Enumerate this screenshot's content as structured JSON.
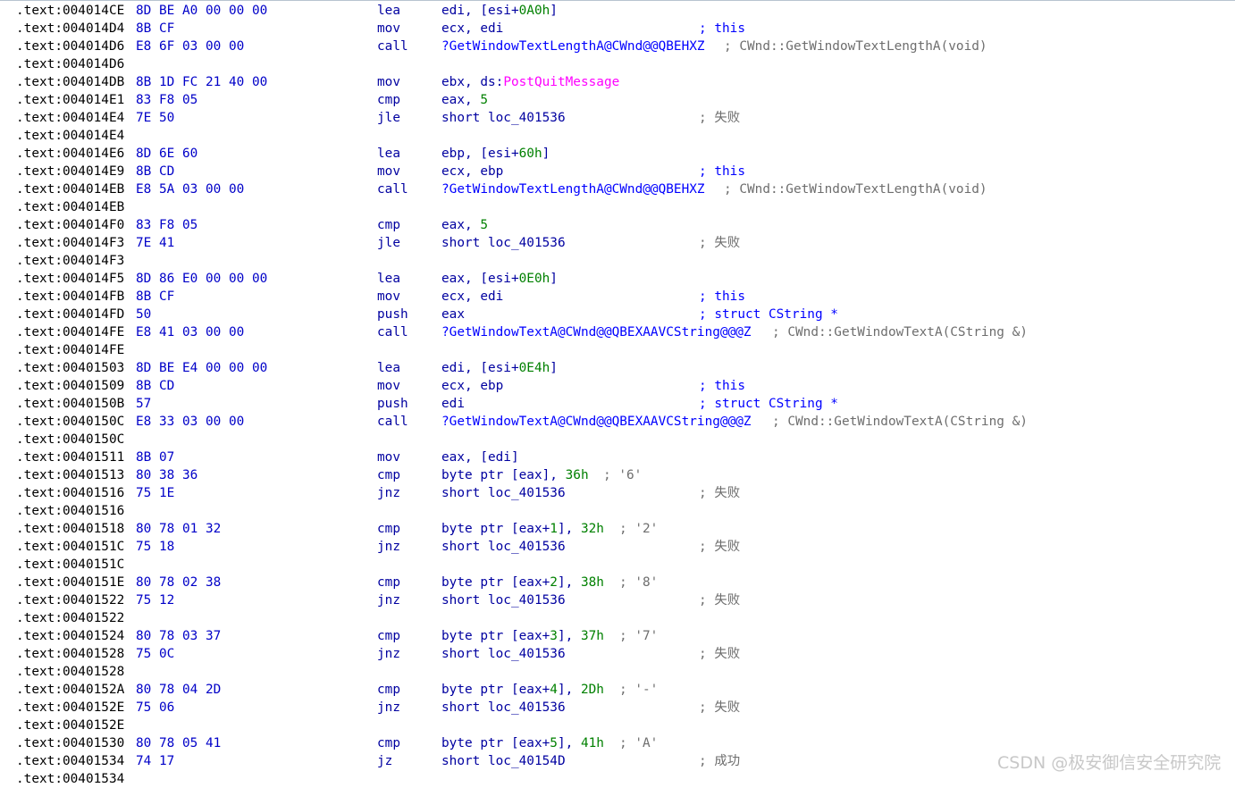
{
  "listing": {
    "lines": [
      {
        "addr": ".text:004014CE",
        "bytes": "8D BE A0 00 00 00",
        "mnem": "lea",
        "ops": [
          {
            "t": "edi, [esi+",
            "c": "reg"
          },
          {
            "t": "0A0h",
            "c": "num"
          },
          {
            "t": "]",
            "c": "reg"
          }
        ],
        "comment": ""
      },
      {
        "addr": ".text:004014D4",
        "bytes": "8B CF",
        "mnem": "mov",
        "ops": [
          {
            "t": "ecx, edi",
            "c": "reg"
          }
        ],
        "comment": "; this",
        "cmtStyle": "blue",
        "cmtCol": 782
      },
      {
        "addr": ".text:004014D6",
        "bytes": "E8 6F 03 00 00",
        "mnem": "call",
        "ops": [
          {
            "t": "?GetWindowTextLengthA@CWnd@@QBEHXZ",
            "c": "func"
          }
        ],
        "comment": "; CWnd::GetWindowTextLengthA(void)",
        "cmtCol": 810
      },
      {
        "addr": ".text:004014D6",
        "bytes": "",
        "mnem": "",
        "ops": [],
        "comment": ""
      },
      {
        "addr": ".text:004014DB",
        "bytes": "8B 1D FC 21 40 00",
        "mnem": "mov",
        "ops": [
          {
            "t": "ebx, ds:",
            "c": "reg"
          },
          {
            "t": "PostQuitMessage",
            "c": "name"
          }
        ],
        "comment": ""
      },
      {
        "addr": ".text:004014E1",
        "bytes": "83 F8 05",
        "mnem": "cmp",
        "ops": [
          {
            "t": "eax, ",
            "c": "reg"
          },
          {
            "t": "5",
            "c": "num"
          }
        ],
        "comment": ""
      },
      {
        "addr": ".text:004014E4",
        "bytes": "7E 50",
        "mnem": "jle",
        "ops": [
          {
            "t": "short loc_401536",
            "c": "loc"
          }
        ],
        "comment": "; 失败",
        "cmtCol": 782
      },
      {
        "addr": ".text:004014E4",
        "bytes": "",
        "mnem": "",
        "ops": [],
        "comment": ""
      },
      {
        "addr": ".text:004014E6",
        "bytes": "8D 6E 60",
        "mnem": "lea",
        "ops": [
          {
            "t": "ebp, [esi+",
            "c": "reg"
          },
          {
            "t": "60h",
            "c": "num"
          },
          {
            "t": "]",
            "c": "reg"
          }
        ],
        "comment": ""
      },
      {
        "addr": ".text:004014E9",
        "bytes": "8B CD",
        "mnem": "mov",
        "ops": [
          {
            "t": "ecx, ebp",
            "c": "reg"
          }
        ],
        "comment": "; this",
        "cmtStyle": "blue",
        "cmtCol": 782
      },
      {
        "addr": ".text:004014EB",
        "bytes": "E8 5A 03 00 00",
        "mnem": "call",
        "ops": [
          {
            "t": "?GetWindowTextLengthA@CWnd@@QBEHXZ",
            "c": "func"
          }
        ],
        "comment": "; CWnd::GetWindowTextLengthA(void)",
        "cmtCol": 810
      },
      {
        "addr": ".text:004014EB",
        "bytes": "",
        "mnem": "",
        "ops": [],
        "comment": ""
      },
      {
        "addr": ".text:004014F0",
        "bytes": "83 F8 05",
        "mnem": "cmp",
        "ops": [
          {
            "t": "eax, ",
            "c": "reg"
          },
          {
            "t": "5",
            "c": "num"
          }
        ],
        "comment": ""
      },
      {
        "addr": ".text:004014F3",
        "bytes": "7E 41",
        "mnem": "jle",
        "ops": [
          {
            "t": "short loc_401536",
            "c": "loc"
          }
        ],
        "comment": "; 失败",
        "cmtCol": 782
      },
      {
        "addr": ".text:004014F3",
        "bytes": "",
        "mnem": "",
        "ops": [],
        "comment": ""
      },
      {
        "addr": ".text:004014F5",
        "bytes": "8D 86 E0 00 00 00",
        "mnem": "lea",
        "ops": [
          {
            "t": "eax, [esi+",
            "c": "reg"
          },
          {
            "t": "0E0h",
            "c": "num"
          },
          {
            "t": "]",
            "c": "reg"
          }
        ],
        "comment": ""
      },
      {
        "addr": ".text:004014FB",
        "bytes": "8B CF",
        "mnem": "mov",
        "ops": [
          {
            "t": "ecx, edi",
            "c": "reg"
          }
        ],
        "comment": "; this",
        "cmtStyle": "blue",
        "cmtCol": 782
      },
      {
        "addr": ".text:004014FD",
        "bytes": "50",
        "mnem": "push",
        "ops": [
          {
            "t": "eax",
            "c": "reg"
          }
        ],
        "comment": "; struct CString *",
        "cmtStyle": "blue",
        "cmtCol": 782
      },
      {
        "addr": ".text:004014FE",
        "bytes": "E8 41 03 00 00",
        "mnem": "call",
        "ops": [
          {
            "t": "?GetWindowTextA@CWnd@@QBEXAAVCString@@@Z",
            "c": "func"
          }
        ],
        "comment": "; CWnd::GetWindowTextA(CString &)",
        "cmtCol": 864
      },
      {
        "addr": ".text:004014FE",
        "bytes": "",
        "mnem": "",
        "ops": [],
        "comment": ""
      },
      {
        "addr": ".text:00401503",
        "bytes": "8D BE E4 00 00 00",
        "mnem": "lea",
        "ops": [
          {
            "t": "edi, [esi+",
            "c": "reg"
          },
          {
            "t": "0E4h",
            "c": "num"
          },
          {
            "t": "]",
            "c": "reg"
          }
        ],
        "comment": ""
      },
      {
        "addr": ".text:00401509",
        "bytes": "8B CD",
        "mnem": "mov",
        "ops": [
          {
            "t": "ecx, ebp",
            "c": "reg"
          }
        ],
        "comment": "; this",
        "cmtStyle": "blue",
        "cmtCol": 782
      },
      {
        "addr": ".text:0040150B",
        "bytes": "57",
        "mnem": "push",
        "ops": [
          {
            "t": "edi",
            "c": "reg"
          }
        ],
        "comment": "; struct CString *",
        "cmtStyle": "blue",
        "cmtCol": 782
      },
      {
        "addr": ".text:0040150C",
        "bytes": "E8 33 03 00 00",
        "mnem": "call",
        "ops": [
          {
            "t": "?GetWindowTextA@CWnd@@QBEXAAVCString@@@Z",
            "c": "func"
          }
        ],
        "comment": "; CWnd::GetWindowTextA(CString &)",
        "cmtCol": 864
      },
      {
        "addr": ".text:0040150C",
        "bytes": "",
        "mnem": "",
        "ops": [],
        "comment": ""
      },
      {
        "addr": ".text:00401511",
        "bytes": "8B 07",
        "mnem": "mov",
        "ops": [
          {
            "t": "eax, [edi]",
            "c": "reg"
          }
        ],
        "comment": ""
      },
      {
        "addr": ".text:00401513",
        "bytes": "80 38 36",
        "mnem": "cmp",
        "ops": [
          {
            "t": "byte ptr [eax], ",
            "c": "reg"
          },
          {
            "t": "36h",
            "c": "num"
          }
        ],
        "comment": "; '6'",
        "cmtCol": 675
      },
      {
        "addr": ".text:00401516",
        "bytes": "75 1E",
        "mnem": "jnz",
        "ops": [
          {
            "t": "short loc_401536",
            "c": "loc"
          }
        ],
        "comment": "; 失败",
        "cmtCol": 782
      },
      {
        "addr": ".text:00401516",
        "bytes": "",
        "mnem": "",
        "ops": [],
        "comment": ""
      },
      {
        "addr": ".text:00401518",
        "bytes": "80 78 01 32",
        "mnem": "cmp",
        "ops": [
          {
            "t": "byte ptr [eax+",
            "c": "reg"
          },
          {
            "t": "1",
            "c": "num"
          },
          {
            "t": "], ",
            "c": "reg"
          },
          {
            "t": "32h",
            "c": "num"
          }
        ],
        "comment": "; '2'",
        "cmtCol": 693
      },
      {
        "addr": ".text:0040151C",
        "bytes": "75 18",
        "mnem": "jnz",
        "ops": [
          {
            "t": "short loc_401536",
            "c": "loc"
          }
        ],
        "comment": "; 失败",
        "cmtCol": 782
      },
      {
        "addr": ".text:0040151C",
        "bytes": "",
        "mnem": "",
        "ops": [],
        "comment": ""
      },
      {
        "addr": ".text:0040151E",
        "bytes": "80 78 02 38",
        "mnem": "cmp",
        "ops": [
          {
            "t": "byte ptr [eax+",
            "c": "reg"
          },
          {
            "t": "2",
            "c": "num"
          },
          {
            "t": "], ",
            "c": "reg"
          },
          {
            "t": "38h",
            "c": "num"
          }
        ],
        "comment": "; '8'",
        "cmtCol": 693
      },
      {
        "addr": ".text:00401522",
        "bytes": "75 12",
        "mnem": "jnz",
        "ops": [
          {
            "t": "short loc_401536",
            "c": "loc"
          }
        ],
        "comment": "; 失败",
        "cmtCol": 782
      },
      {
        "addr": ".text:00401522",
        "bytes": "",
        "mnem": "",
        "ops": [],
        "comment": ""
      },
      {
        "addr": ".text:00401524",
        "bytes": "80 78 03 37",
        "mnem": "cmp",
        "ops": [
          {
            "t": "byte ptr [eax+",
            "c": "reg"
          },
          {
            "t": "3",
            "c": "num"
          },
          {
            "t": "], ",
            "c": "reg"
          },
          {
            "t": "37h",
            "c": "num"
          }
        ],
        "comment": "; '7'",
        "cmtCol": 693
      },
      {
        "addr": ".text:00401528",
        "bytes": "75 0C",
        "mnem": "jnz",
        "ops": [
          {
            "t": "short loc_401536",
            "c": "loc"
          }
        ],
        "comment": "; 失败",
        "cmtCol": 782
      },
      {
        "addr": ".text:00401528",
        "bytes": "",
        "mnem": "",
        "ops": [],
        "comment": ""
      },
      {
        "addr": ".text:0040152A",
        "bytes": "80 78 04 2D",
        "mnem": "cmp",
        "ops": [
          {
            "t": "byte ptr [eax+",
            "c": "reg"
          },
          {
            "t": "4",
            "c": "num"
          },
          {
            "t": "], ",
            "c": "reg"
          },
          {
            "t": "2Dh",
            "c": "num"
          }
        ],
        "comment": "; '-'",
        "cmtCol": 693
      },
      {
        "addr": ".text:0040152E",
        "bytes": "75 06",
        "mnem": "jnz",
        "ops": [
          {
            "t": "short loc_401536",
            "c": "loc"
          }
        ],
        "comment": "; 失败",
        "cmtCol": 782
      },
      {
        "addr": ".text:0040152E",
        "bytes": "",
        "mnem": "",
        "ops": [],
        "comment": ""
      },
      {
        "addr": ".text:00401530",
        "bytes": "80 78 05 41",
        "mnem": "cmp",
        "ops": [
          {
            "t": "byte ptr [eax+",
            "c": "reg"
          },
          {
            "t": "5",
            "c": "num"
          },
          {
            "t": "], ",
            "c": "reg"
          },
          {
            "t": "41h",
            "c": "num"
          }
        ],
        "comment": "; 'A'",
        "cmtCol": 693
      },
      {
        "addr": ".text:00401534",
        "bytes": "74 17",
        "mnem": "jz",
        "ops": [
          {
            "t": "short loc_40154D",
            "c": "loc"
          }
        ],
        "comment": "; 成功",
        "cmtCol": 782
      },
      {
        "addr": ".text:00401534",
        "bytes": "",
        "mnem": "",
        "ops": [],
        "comment": ""
      }
    ]
  },
  "watermark": "CSDN @极安御信安全研究院"
}
